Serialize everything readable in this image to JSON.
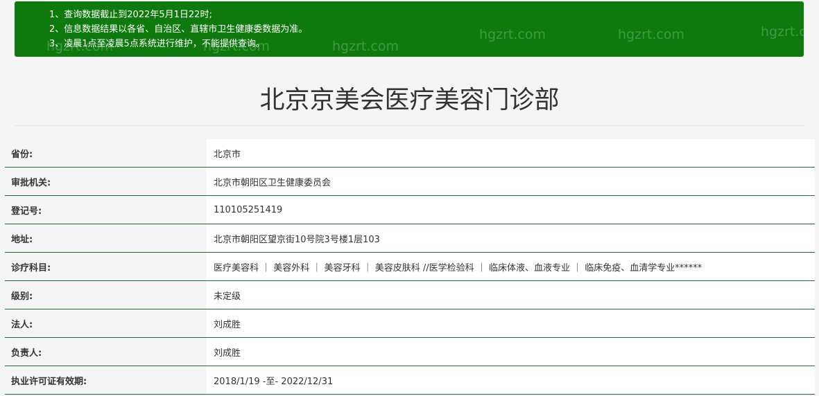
{
  "notice": {
    "lines": [
      "1、查询数据截止到2022年5月1日22时;",
      "2、信息数据结果以各省、自治区、直辖市卫生健康委数据为准。",
      "3、凌晨1点至凌晨5点系统进行维护，不能提供查询。"
    ],
    "watermark": "hgzrt.com",
    "bg_color": "#0e7a0d"
  },
  "title": "北京京美会医疗美容门诊部",
  "rows": [
    {
      "label": "省份:",
      "value": "北京市"
    },
    {
      "label": "审批机关:",
      "value": "北京市朝阳区卫生健康委员会"
    },
    {
      "label": "登记号:",
      "value": "110105251419"
    },
    {
      "label": "地址:",
      "value": "北京市朝阳区望京街10号院3号楼1层103"
    },
    {
      "label": "诊疗科目:",
      "value": "医疗美容科 ｜ 美容外科 ｜ 美容牙科 ｜ 美容皮肤科 //医学检验科 ｜ 临床体液、血液专业 ｜ 临床免疫、血清学专业******"
    },
    {
      "label": "级别:",
      "value": "未定级"
    },
    {
      "label": "法人:",
      "value": "刘成胜"
    },
    {
      "label": "负责人:",
      "value": "刘成胜"
    },
    {
      "label": "执业许可证有效期:",
      "value": "2018/1/19 -至- 2022/12/31"
    }
  ],
  "row_border_color": "#1d6b32"
}
